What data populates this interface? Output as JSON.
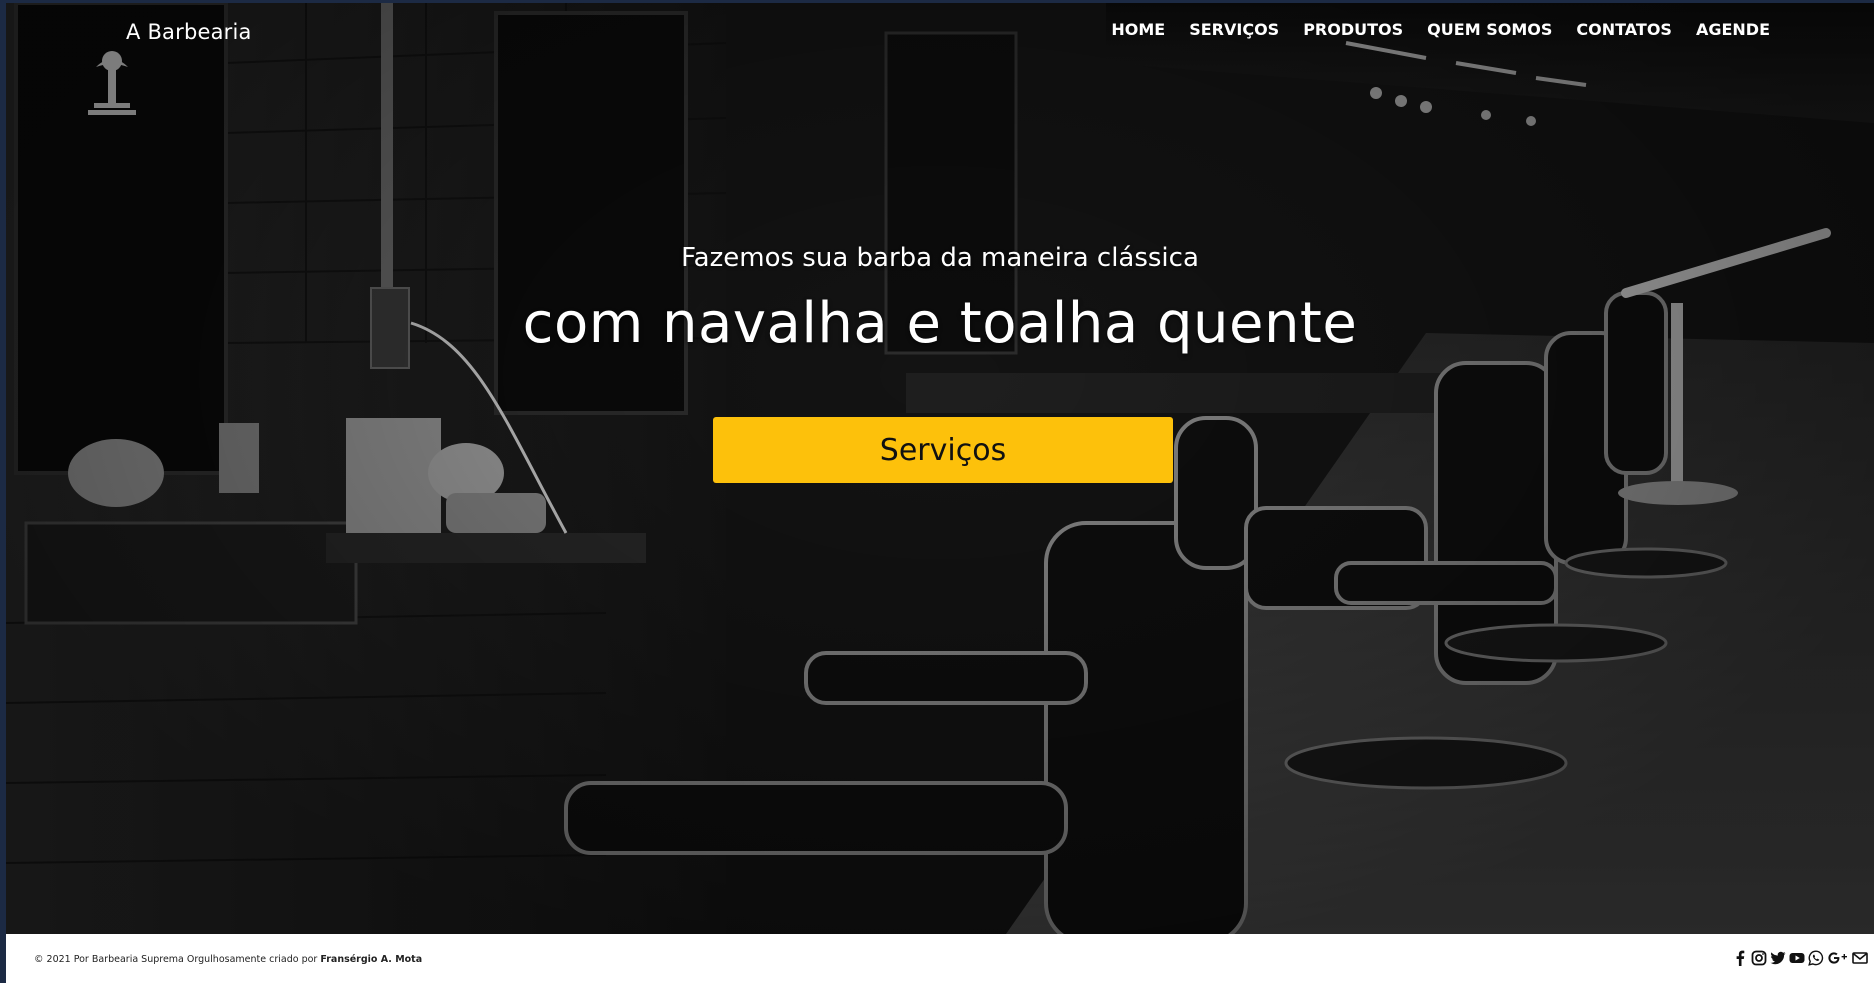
{
  "navbar": {
    "brand": "A Barbearia",
    "links": [
      "HOME",
      "SERVIÇOS",
      "PRODUTOS",
      "QUEM SOMOS",
      "CONTATOS",
      "AGENDE"
    ]
  },
  "hero": {
    "subtitle": "Fazemos sua barba da maneira clássica",
    "title": "com navalha e toalha quente",
    "button_label": "Serviços",
    "button_color": "#fdc10b"
  },
  "footer": {
    "copyright_prefix": "© 2021 Por Barbearia Suprema Orgulhosamente criado por ",
    "author": "Fransérgio A. Mota",
    "social_icons": [
      "facebook-icon",
      "instagram-icon",
      "twitter-icon",
      "youtube-icon",
      "whatsapp-icon",
      "google-plus-icon",
      "email-icon"
    ]
  }
}
